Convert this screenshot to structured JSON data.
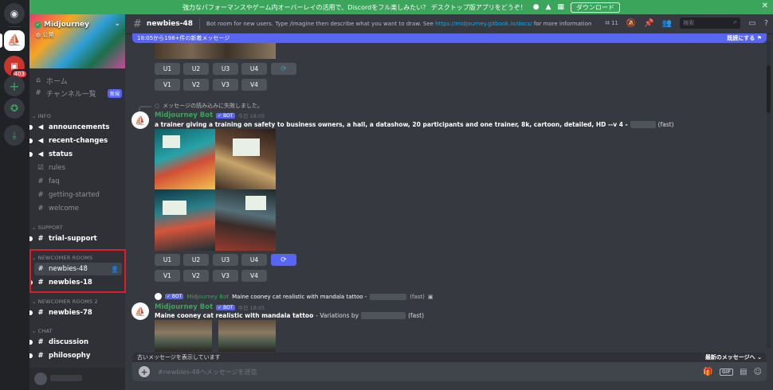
{
  "banner": {
    "text": "強力なパフォーマンスやゲーム内オーバーレイの活用で、Discordをフル楽しみたい？ デスクトップ版アプリをどうぞ！",
    "download_label": "ダウンロード"
  },
  "rail": {
    "notif_badge": "403"
  },
  "server": {
    "name": "Midjourney",
    "public_label": "公開"
  },
  "nav": {
    "home": "ホーム",
    "channel_list": "チャンネル一覧",
    "new_badge": "新規"
  },
  "categories": {
    "info": "INFO",
    "support": "SUPPORT",
    "newcomer": "NEWCOMER ROOMS",
    "newcomer2": "NEWCOMER ROOMS 2",
    "chat": "CHAT"
  },
  "channels": {
    "announcements": "announcements",
    "recent_changes": "recent-changes",
    "status": "status",
    "rules": "rules",
    "faq": "faq",
    "getting_started": "getting-started",
    "welcome": "welcome",
    "trial_support": "trial-support",
    "newbies_48": "newbies-48",
    "newbies_18": "newbies-18",
    "newbies_78": "newbies-78",
    "discussion": "discussion",
    "philosophy": "philosophy"
  },
  "header": {
    "channel": "newbies-48",
    "topic_prefix": "Bot room for new users. Type /imagine then describe what you want to draw. See",
    "topic_link": "https://midjourney.gitbook.io/docs/",
    "topic_suffix": "for more information",
    "thread_count": "11",
    "search_placeholder": "検索"
  },
  "new_messages": {
    "text": "18:05から198+件の新着メッセージ",
    "mark_read": "既読にする"
  },
  "buttons": {
    "u1": "U1",
    "u2": "U2",
    "u3": "U3",
    "u4": "U4",
    "v1": "V1",
    "v2": "V2",
    "v3": "V3",
    "v4": "V4"
  },
  "message1": {
    "reply_failed": "メッセージの読み込みに失敗しました。",
    "author": "Midjourney Bot",
    "bot_tag": "✓ BOT",
    "time": "今日 18:05",
    "prompt": "a trainer giving a training on safety to business owners, a hall, a datashow, 20 participants and one trainer, 8k, cartoon, detailed, HD --v 4 -",
    "speed": "(fast)"
  },
  "message2": {
    "reply_author": "Midjourney Bot",
    "reply_text": "Maine cooney cat realistic with mandala tattoo -",
    "reply_speed": "(fast)",
    "author": "Midjourney Bot",
    "bot_tag": "✓ BOT",
    "time": "今日 18:05",
    "prompt": "Maine cooney cat realistic with mandala tattoo",
    "variations": "- Variations by",
    "speed": "(fast)"
  },
  "bottom": {
    "old_messages": "古いメッセージを表示しています",
    "jump": "最新のメッセージへ",
    "placeholder": "#newbies-48へメッセージを送信"
  }
}
